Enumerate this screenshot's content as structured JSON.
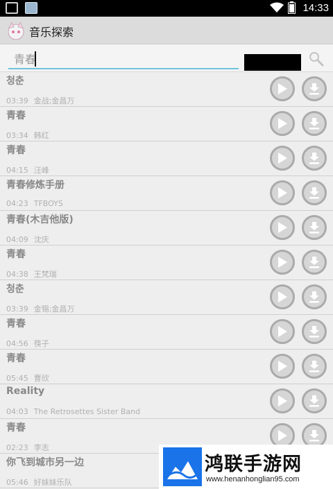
{
  "status_bar": {
    "time": "14:33"
  },
  "app": {
    "title": "音乐探索"
  },
  "search": {
    "value": "青春"
  },
  "songs": [
    {
      "title": "청춘",
      "duration": "03:39",
      "artist": "金战;金昌万"
    },
    {
      "title": "青春",
      "duration": "03:34",
      "artist": "韩红"
    },
    {
      "title": "青春",
      "duration": "04:15",
      "artist": "汪峰"
    },
    {
      "title": "青春修炼手册",
      "duration": "04:23",
      "artist": "TFBOYS"
    },
    {
      "title": "青春(木吉他版)",
      "duration": "04:09",
      "artist": "沈庆"
    },
    {
      "title": "青春",
      "duration": "04:38",
      "artist": "王梵瑞"
    },
    {
      "title": "청춘",
      "duration": "03:39",
      "artist": "金锡;金昌万"
    },
    {
      "title": "青春",
      "duration": "04:56",
      "artist": "筷子"
    },
    {
      "title": "青春",
      "duration": "05:45",
      "artist": "曹欣"
    },
    {
      "title": "Reality",
      "duration": "04:03",
      "artist": "The Retrosettes Sister Band"
    },
    {
      "title": "青春",
      "duration": "02:23",
      "artist": "李志"
    },
    {
      "title": "你飞到城市另一边",
      "duration": "05:46",
      "artist": "好妹妹乐队"
    }
  ],
  "watermark": {
    "name": "鸿联手游网",
    "url": "www.henanhonglian95.com"
  },
  "colors": {
    "accent": "#6ec3da",
    "button_ring": "#aaaaaa",
    "button_fill": "#d6d6d6"
  }
}
